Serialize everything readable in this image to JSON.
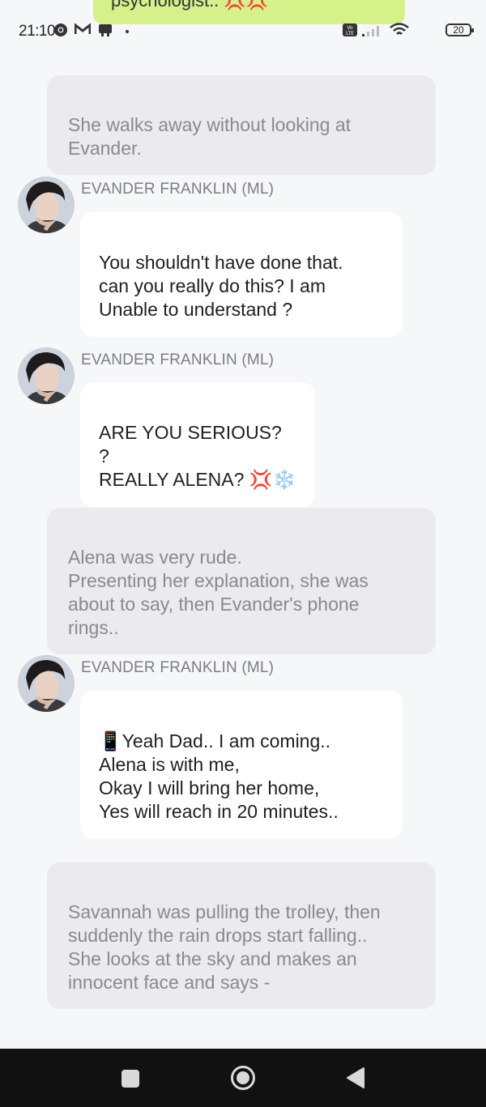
{
  "notification": {
    "text": "psychologist.. 💢💢"
  },
  "status_bar": {
    "time": "21:10",
    "battery": "20",
    "network_badge": "Vo LTE",
    "icons": [
      "chrome-icon",
      "gmail-icon",
      "notification-icon",
      "dot-icon",
      "volte-icon",
      "signal-icon",
      "wifi-icon",
      "battery-icon"
    ]
  },
  "messages": [
    {
      "type": "narration",
      "text": "She walks away without looking at\nEvander."
    },
    {
      "type": "character",
      "speaker": "EVANDER FRANKLIN (ML)",
      "text": "You shouldn't have done that.\ncan you really do this? I am\nUnable to understand ?"
    },
    {
      "type": "character",
      "speaker": "EVANDER FRANKLIN (ML)",
      "text": "ARE YOU SERIOUS? ?\nREALLY ALENA? 💢❄️"
    },
    {
      "type": "narration",
      "text": "Alena was very rude.\nPresenting her explanation, she was\nabout to say, then Evander's phone\nrings.."
    },
    {
      "type": "character",
      "speaker": "EVANDER FRANKLIN (ML)",
      "text": "📱Yeah Dad.. I am coming..\nAlena is with me,\nOkay I will bring her home,\nYes will reach in 20 minutes.."
    },
    {
      "type": "narration",
      "text": "Savannah was pulling the trolley, then\nsuddenly the rain drops start falling..\nShe looks at the sky and makes an\ninnocent face and says -"
    }
  ],
  "nav_bar": {
    "buttons": [
      "recents-button",
      "home-button",
      "back-button"
    ]
  },
  "colors": {
    "background": "#f6f7f9",
    "narration_bg": "#ebebee",
    "narration_text": "#8a8a8e",
    "bubble_bg": "#ffffff",
    "notification_bg": "#d6f08a",
    "nav_bg": "#111111"
  }
}
